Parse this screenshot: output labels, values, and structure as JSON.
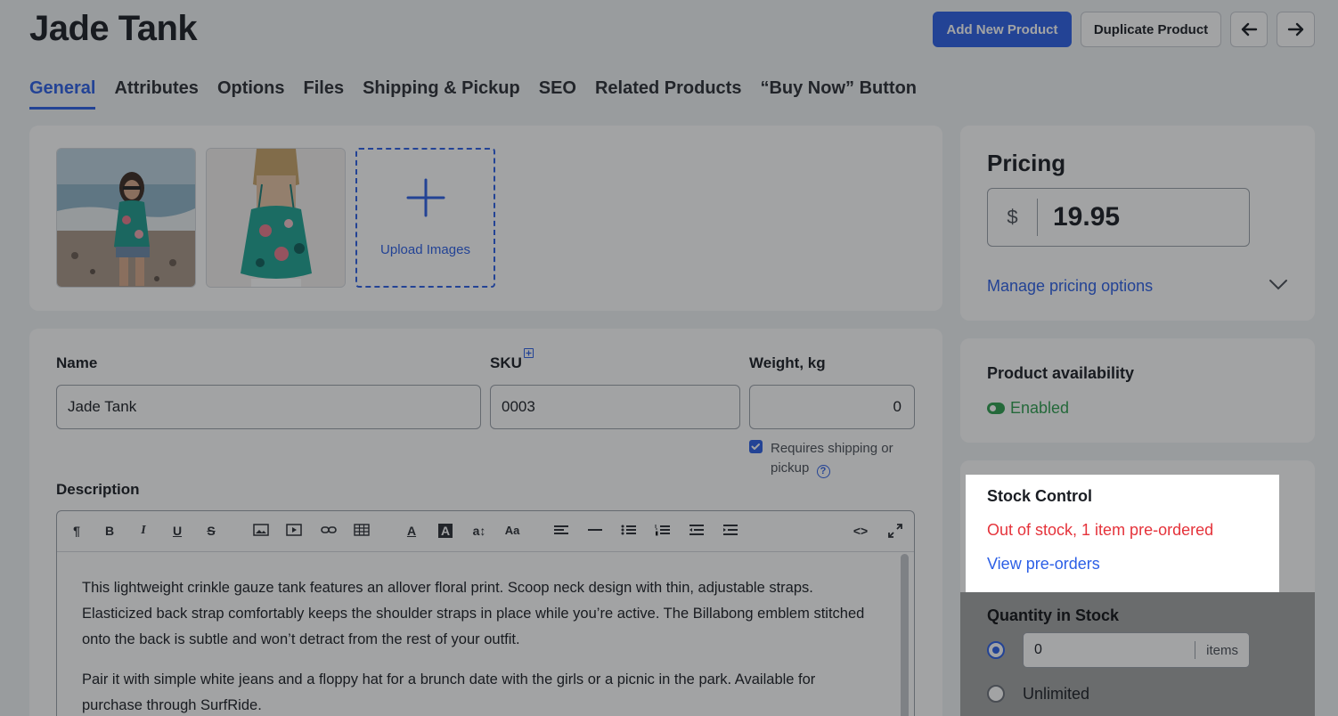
{
  "header": {
    "title": "Jade Tank",
    "add_new_product": "Add New Product",
    "duplicate_product": "Duplicate Product",
    "prev_icon": "arrow-left-icon",
    "next_icon": "arrow-right-icon"
  },
  "tabs": [
    "General",
    "Attributes",
    "Options",
    "Files",
    "Shipping & Pickup",
    "SEO",
    "Related Products",
    "“Buy Now” Button"
  ],
  "images": {
    "upload_label": "Upload Images"
  },
  "form": {
    "name_label": "Name",
    "name_value": "Jade Tank",
    "sku_label": "SKU",
    "sku_value": "0003",
    "weight_label": "Weight, kg",
    "weight_value": "0",
    "requires_shipping_line1": "Requires shipping or",
    "requires_shipping_line2": "pickup",
    "requires_shipping_checked": true,
    "description_label": "Description"
  },
  "editor": {
    "paragraph1": "This lightweight crinkle gauze tank features an allover floral print. Scoop neck design with thin, adjustable straps. Elasticized back strap comfortably keeps the shoulder straps in place while you’re active. The Billabong emblem stitched onto the back is subtle and won’t detract from the rest of your outfit.",
    "paragraph2": "Pair it with simple white jeans and a floppy hat for a brunch date with the girls or a picnic in the park. Available for purchase through SurfRide."
  },
  "pricing": {
    "title": "Pricing",
    "currency": "$",
    "price": "19.95",
    "manage_link": "Manage pricing options"
  },
  "availability": {
    "title": "Product availability",
    "status": "Enabled"
  },
  "stock": {
    "title": "Stock Control",
    "status": "Out of stock, 1 item pre-ordered",
    "view_link": "View pre-orders",
    "quantity_label": "Quantity in Stock",
    "quantity_value": "0",
    "quantity_unit": "items",
    "unlimited_label": "Unlimited"
  },
  "colors": {
    "accent": "#2c5fe6",
    "enabled": "#2e9e4f",
    "danger": "#e5333b"
  }
}
